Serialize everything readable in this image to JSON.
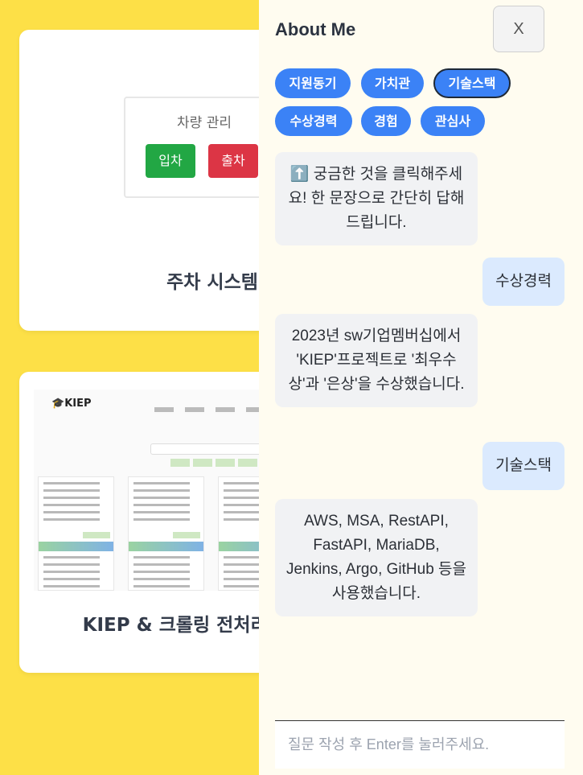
{
  "projects": [
    {
      "title": "주차 시스템",
      "preview": {
        "heading": "차량 관리",
        "enter_label": "입차",
        "exit_label": "출차"
      }
    },
    {
      "title": "KIEP & 크롤링 전처리 프로그램",
      "preview": {
        "logo": "KIEP"
      }
    }
  ],
  "chat": {
    "title": "About Me",
    "close_label": "X",
    "chips": [
      "지원동기",
      "가치관",
      "기술스택",
      "수상경력",
      "경험",
      "관심사"
    ],
    "active_chip": "기술스택",
    "messages": [
      {
        "from": "bot",
        "icon": "up-arrow-icon",
        "text": "⬆️ 궁금한 것을 클릭해주세요! 한 문장으로 간단히 답해드립니다."
      },
      {
        "from": "user",
        "text": "수상경력"
      },
      {
        "from": "bot",
        "text": "2023년 sw기업멤버십에서 'KIEP'프로젝트로 '최우수상'과 '은상'을 수상했습니다."
      },
      {
        "from": "user",
        "text": "기술스택"
      },
      {
        "from": "bot",
        "text": "AWS, MSA, RestAPI, FastAPI, MariaDB, Jenkins, Argo, GitHub 등을 사용했습니다."
      }
    ],
    "input_placeholder": "질문 작성 후 Enter를 눌러주세요."
  },
  "colors": {
    "background": "#fde047",
    "chip": "#3b82f6",
    "user_bubble": "#dbeafe",
    "bot_bubble": "#f1f2f4",
    "enter_button": "#22a744",
    "exit_button": "#dc3545"
  }
}
